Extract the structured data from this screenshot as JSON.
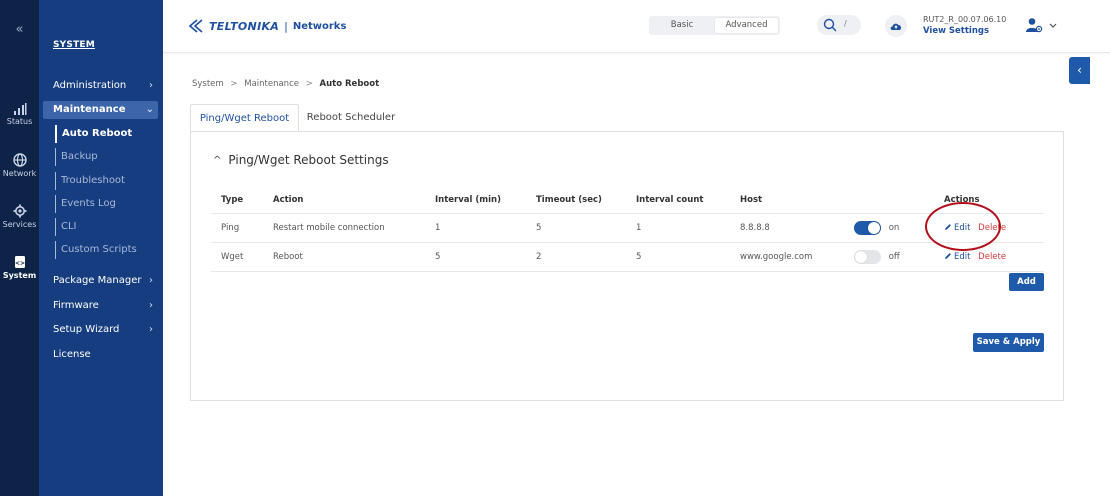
{
  "rail": {
    "collapse_icon": "double-chevron-left-icon",
    "items": [
      {
        "label": "Status",
        "icon": "signal-bars-icon"
      },
      {
        "label": "Network",
        "icon": "globe-icon"
      },
      {
        "label": "Services",
        "icon": "gear-icon"
      },
      {
        "label": "System",
        "icon": "code-file-icon"
      }
    ]
  },
  "sidebar": {
    "title": "SYSTEM",
    "items": [
      {
        "label": "Administration"
      },
      {
        "label": "Maintenance"
      },
      {
        "label": "Package Manager"
      },
      {
        "label": "Firmware"
      },
      {
        "label": "Setup Wizard"
      },
      {
        "label": "License"
      }
    ],
    "maintenance_sub": [
      {
        "label": "Auto Reboot"
      },
      {
        "label": "Backup"
      },
      {
        "label": "Troubleshoot"
      },
      {
        "label": "Events Log"
      },
      {
        "label": "CLI"
      },
      {
        "label": "Custom Scripts"
      }
    ]
  },
  "header": {
    "brand": "TELTONIKA",
    "separator": "|",
    "product": "Networks",
    "mode_basic": "Basic",
    "mode_advanced": "Advanced",
    "search_shortcut": "/",
    "device_name": "RUT2_R_00.07.06.10",
    "device_link": "View Settings"
  },
  "breadcrumb": {
    "items": [
      "System",
      "Maintenance",
      "Auto Reboot"
    ],
    "separator": ">"
  },
  "tabs": [
    "Ping/Wget Reboot",
    "Reboot Scheduler"
  ],
  "section": {
    "title": "Ping/Wget Reboot Settings",
    "columns": [
      "Type",
      "Action",
      "Interval (min)",
      "Timeout (sec)",
      "Interval count",
      "Host",
      "",
      "Actions"
    ],
    "rows": [
      {
        "type": "Ping",
        "action": "Restart mobile connection",
        "interval": "1",
        "timeout": "5",
        "count": "1",
        "host": "8.8.8.8",
        "enabled": "on",
        "edit": "Edit",
        "delete": "Delete"
      },
      {
        "type": "Wget",
        "action": "Reboot",
        "interval": "5",
        "timeout": "2",
        "count": "5",
        "host": "www.google.com",
        "enabled": "off",
        "edit": "Edit",
        "delete": "Delete"
      }
    ],
    "add_label": "Add",
    "save_label": "Save & Apply"
  },
  "colors": {
    "rail_bg": "#0d2347",
    "sidebar_bg": "#163d80",
    "accent": "#1f5aaa",
    "danger": "#d23a3a",
    "highlight": "#b2101a"
  }
}
